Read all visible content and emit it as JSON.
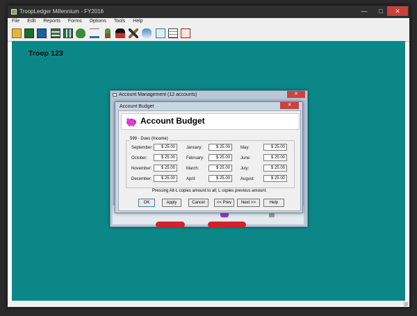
{
  "app": {
    "title": "TroopLedger Millennium - FY2016",
    "menu": [
      "File",
      "Edit",
      "Reports",
      "Forms",
      "Options",
      "Tools",
      "Help"
    ]
  },
  "client": {
    "troop_label": "Troop 123"
  },
  "account_window": {
    "title": "Account Management (12 accounts)"
  },
  "budget_dialog": {
    "window_title": "Account Budget",
    "header_title": "Account Budget",
    "group_label": "599 - Dues (Income)",
    "months": [
      {
        "label": "September:",
        "value": "$ 25.00"
      },
      {
        "label": "October:",
        "value": "$ 25.00"
      },
      {
        "label": "November:",
        "value": "$ 25.00"
      },
      {
        "label": "December:",
        "value": "$ 25.00"
      },
      {
        "label": "January:",
        "value": "$ 25.00"
      },
      {
        "label": "February:",
        "value": "$ 25.00"
      },
      {
        "label": "March:",
        "value": "$ 25.00"
      },
      {
        "label": "April:",
        "value": "$ 25.00"
      },
      {
        "label": "May:",
        "value": "$ 25.00"
      },
      {
        "label": "June:",
        "value": "$ 25.00"
      },
      {
        "label": "July:",
        "value": "$ 25.00"
      },
      {
        "label": "August:",
        "value": "$ 25.00"
      }
    ],
    "note": "Pressing Alt-L copies amount to all; L copies previous amount.",
    "buttons": {
      "ok": "OK",
      "apply": "Apply",
      "cancel": "Cancel",
      "prev": "<< Prev",
      "next": "Next >>",
      "help": "Help"
    }
  },
  "toolbar_icons": [
    "open-folder-icon",
    "save-icon",
    "save-as-icon",
    "register-icon",
    "ledger-icon",
    "money-bag-icon",
    "scales-icon",
    "scout-icon",
    "member-icon",
    "tools-icon",
    "handshake-icon",
    "notepad-icon",
    "grid-icon",
    "report-icon"
  ],
  "colors": {
    "client_bg": "#0c8787",
    "dialog_frame": "#c9d6e4",
    "close_red": "#c9443d"
  }
}
